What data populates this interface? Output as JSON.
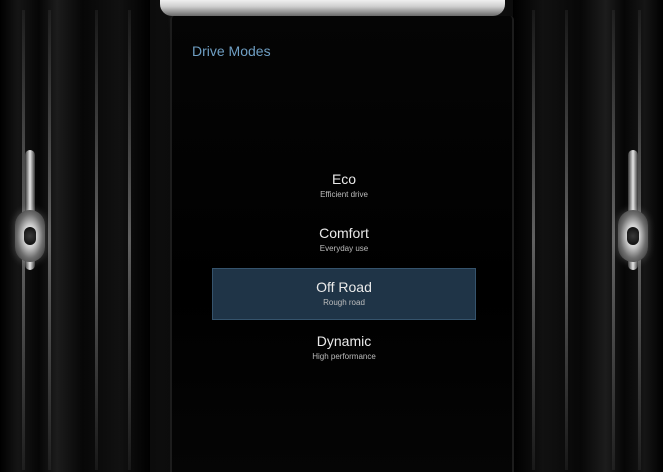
{
  "screen": {
    "title": "Drive Modes"
  },
  "modes": [
    {
      "name": "Eco",
      "description": "Efficient drive",
      "selected": false
    },
    {
      "name": "Comfort",
      "description": "Everyday use",
      "selected": false
    },
    {
      "name": "Off Road",
      "description": "Rough road",
      "selected": true
    },
    {
      "name": "Dynamic",
      "description": "High performance",
      "selected": false
    }
  ],
  "colors": {
    "title": "#6f9fc4",
    "selected_bg": "#1f3447",
    "text": "#eaeaea"
  }
}
